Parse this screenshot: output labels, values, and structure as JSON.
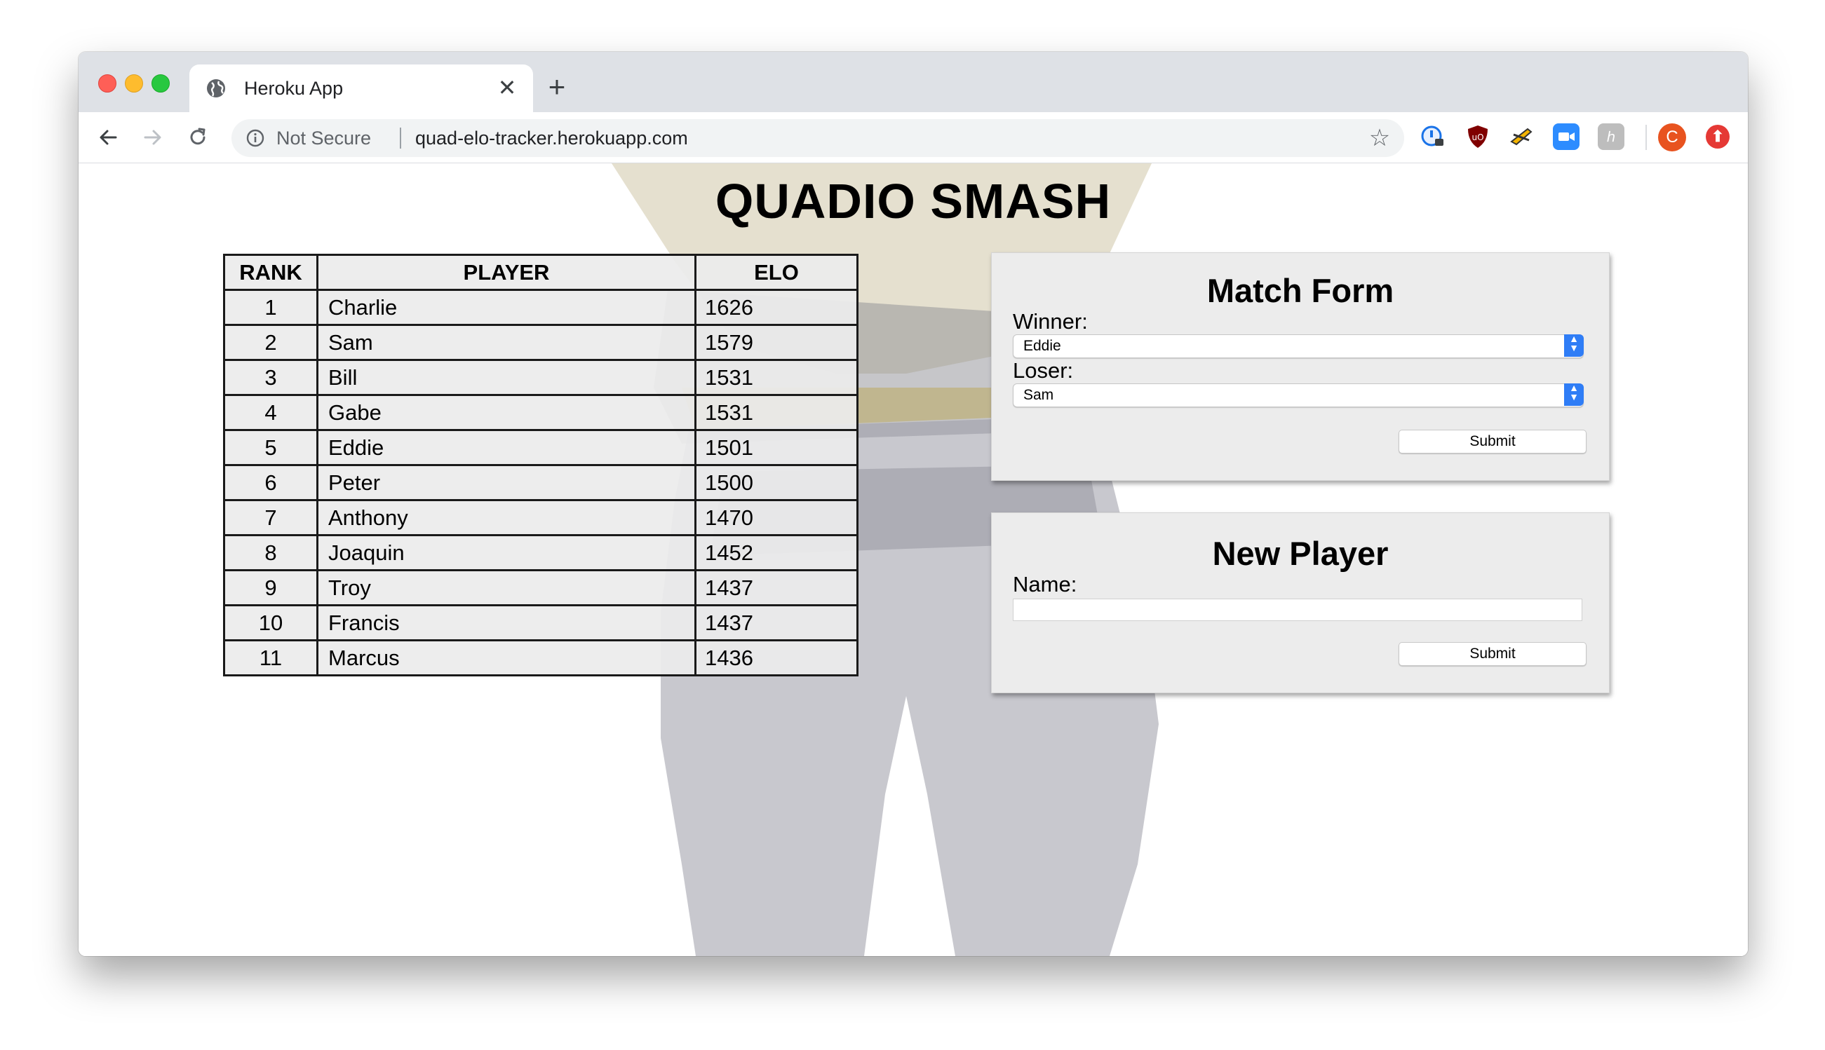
{
  "browser": {
    "tab_title": "Heroku App",
    "tab_close": "✕",
    "new_tab": "+",
    "security_label": "Not Secure",
    "url": "quad-elo-tracker.herokuapp.com",
    "profile_initial": "C",
    "icons": [
      "globe-icon",
      "back-arrow-icon",
      "forward-arrow-icon",
      "reload-icon",
      "info-icon",
      "bookmark-star-icon",
      "password-manager-icon",
      "ublock-icon",
      "extension-icon",
      "zoom-icon",
      "extension-gray-icon",
      "update-icon"
    ]
  },
  "page": {
    "title": "QUADIO SMASH"
  },
  "rankings": {
    "headers": [
      "RANK",
      "PLAYER",
      "ELO"
    ],
    "rows": [
      {
        "rank": "1",
        "player": "Charlie",
        "elo": "1626"
      },
      {
        "rank": "2",
        "player": "Sam",
        "elo": "1579"
      },
      {
        "rank": "3",
        "player": "Bill",
        "elo": "1531"
      },
      {
        "rank": "4",
        "player": "Gabe",
        "elo": "1531"
      },
      {
        "rank": "5",
        "player": "Eddie",
        "elo": "1501"
      },
      {
        "rank": "6",
        "player": "Peter",
        "elo": "1500"
      },
      {
        "rank": "7",
        "player": "Anthony",
        "elo": "1470"
      },
      {
        "rank": "8",
        "player": "Joaquin",
        "elo": "1452"
      },
      {
        "rank": "9",
        "player": "Troy",
        "elo": "1437"
      },
      {
        "rank": "10",
        "player": "Francis",
        "elo": "1437"
      },
      {
        "rank": "11",
        "player": "Marcus",
        "elo": "1436"
      }
    ]
  },
  "match_form": {
    "title": "Match Form",
    "winner_label": "Winner:",
    "winner_value": "Eddie",
    "loser_label": "Loser:",
    "loser_value": "Sam",
    "submit_label": "Submit"
  },
  "new_player_form": {
    "title": "New Player",
    "name_label": "Name:",
    "name_value": "",
    "submit_label": "Submit"
  },
  "colors": {
    "tabbar_bg": "#dee1e6",
    "select_accent": "#2f7df6",
    "avatar": "#e8531f"
  }
}
